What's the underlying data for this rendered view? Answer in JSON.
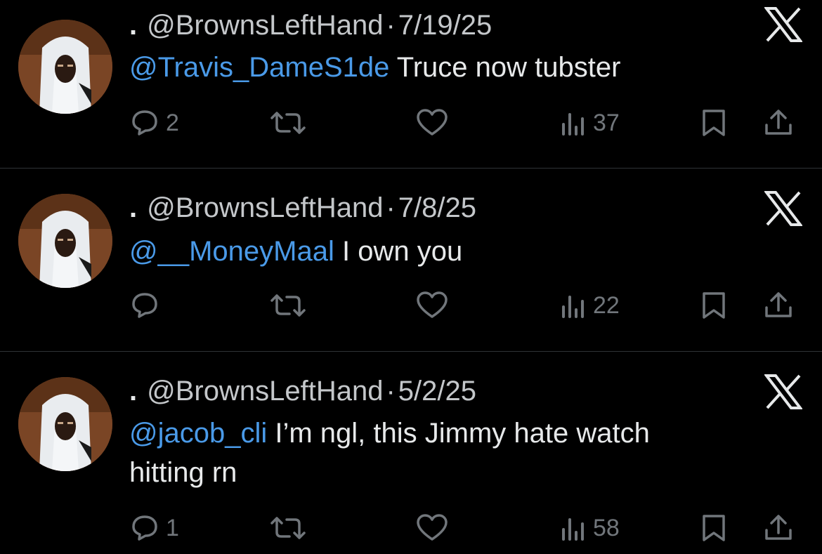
{
  "tweets": [
    {
      "display_name": ".",
      "handle": "@BrownsLeftHand",
      "separator": "·",
      "date": "7/19/25",
      "mention": "@Travis_DameS1de",
      "text": " Truce now tubster",
      "text_line2": "",
      "reply_count": "2",
      "retweet_count": "",
      "like_count": "",
      "view_count": "37"
    },
    {
      "display_name": ".",
      "handle": "@BrownsLeftHand",
      "separator": "·",
      "date": "7/8/25",
      "mention": "@__MoneyMaal",
      "text": " I own you",
      "text_line2": "",
      "reply_count": "",
      "retweet_count": "",
      "like_count": "",
      "view_count": "22"
    },
    {
      "display_name": ".",
      "handle": "@BrownsLeftHand",
      "separator": "·",
      "date": "5/2/25",
      "mention": "@jacob_cli",
      "text": " I’m ngl, this Jimmy hate watch",
      "text_line2": "hitting rn",
      "reply_count": "1",
      "retweet_count": "",
      "like_count": "",
      "view_count": "58"
    }
  ],
  "icons": {
    "reply": "reply-icon",
    "retweet": "retweet-icon",
    "like": "heart-icon",
    "views": "views-icon",
    "bookmark": "bookmark-icon",
    "share": "share-icon",
    "brand": "x-logo-icon"
  },
  "colors": {
    "background": "#000000",
    "text": "#e7e9ea",
    "muted": "#71767b",
    "mention": "#4a9ae8",
    "divider": "#2f3336"
  }
}
